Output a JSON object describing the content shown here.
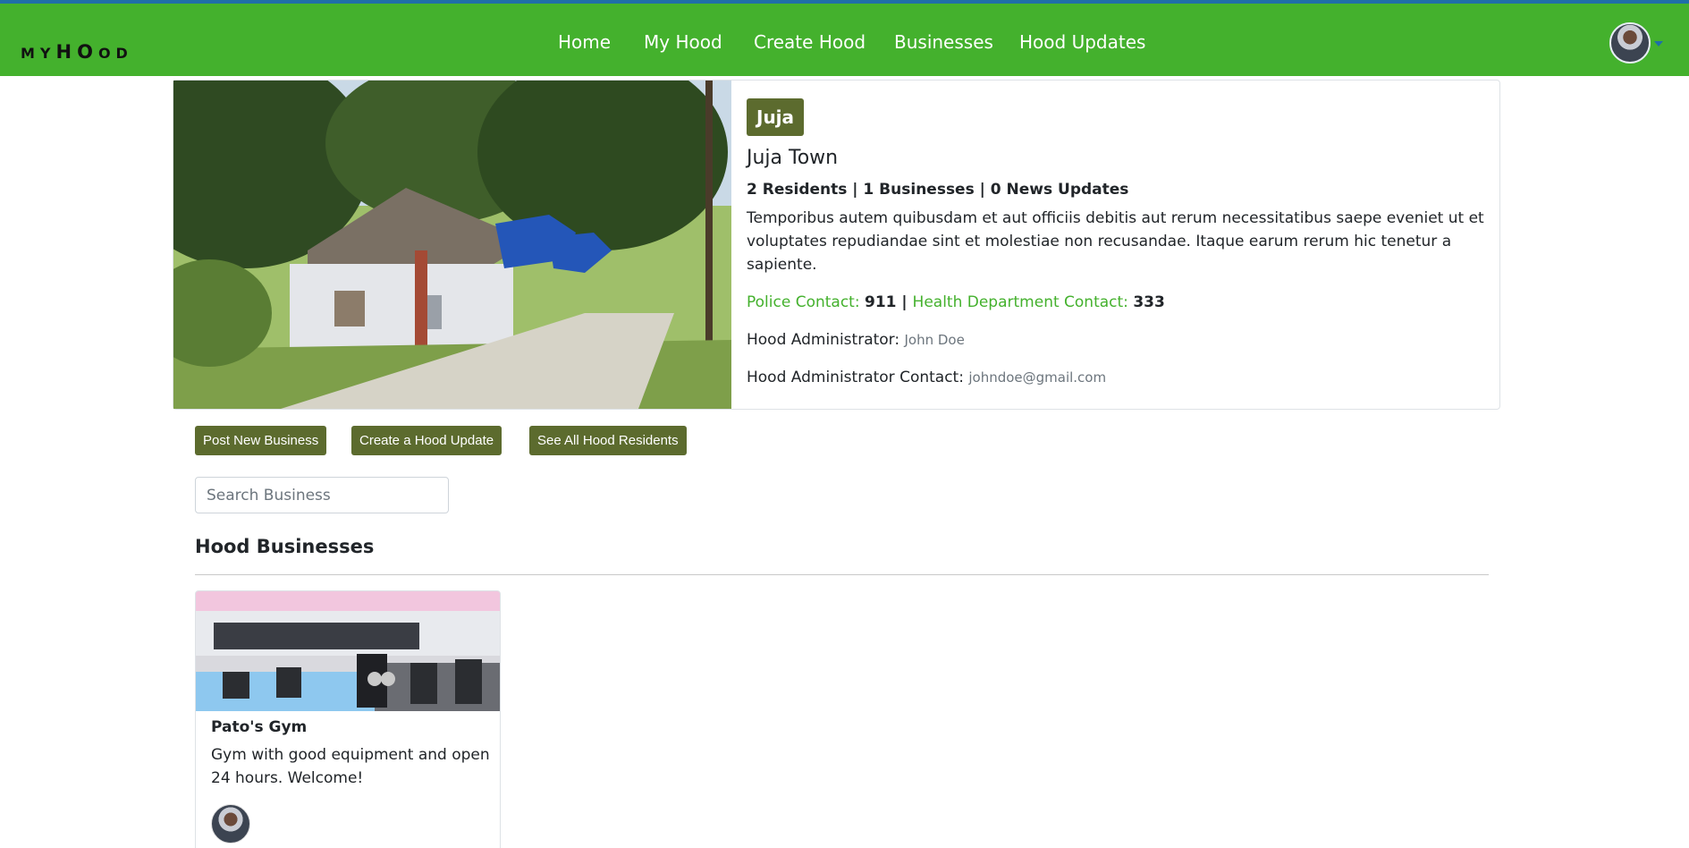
{
  "navbar": {
    "brand": {
      "small_left": "MY",
      "big": "HO",
      "small_right": "OD"
    },
    "links": [
      "Home",
      "My Hood",
      "Create Hood",
      "Businesses",
      "Hood Updates"
    ],
    "colors": {
      "background": "#44b12d",
      "top_border": "#1f6fa8"
    }
  },
  "hood": {
    "badge": "Juja",
    "town": "Juja Town",
    "stats": {
      "residents": "2",
      "residents_label": " Residents | ",
      "businesses": "1",
      "businesses_label": " Businesses | ",
      "news": "0",
      "news_label": " News Updates"
    },
    "description": "Temporibus autem quibusdam et aut officiis debitis aut rerum necessitatibus saepe eveniet ut et voluptates repudiandae sint et molestiae non recusandae. Itaque earum rerum hic tenetur a sapiente.",
    "police_label": "Police Contact: ",
    "police_value": "911",
    "separator": " | ",
    "health_label": "Health Department Contact: ",
    "health_value": "333",
    "admin_label": "Hood Administrator: ",
    "admin_value": "John Doe",
    "admin_contact_label": "Hood Administrator Contact: ",
    "admin_contact_value": "johndoe@gmail.com",
    "accent_color": "#5c6b2e"
  },
  "actions": {
    "post_business": "Post New Business",
    "create_update": "Create a Hood Update",
    "see_residents": "See All Hood Residents"
  },
  "search": {
    "placeholder": "Search Business"
  },
  "businesses_section": {
    "title": "Hood Businesses",
    "items": [
      {
        "name": "Pato's Gym",
        "description": "Gym with good equipment and open 24 hours. Welcome!"
      }
    ]
  }
}
